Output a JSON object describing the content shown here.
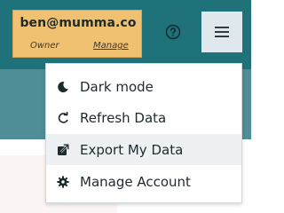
{
  "account": {
    "email": "ben@mumma.co",
    "role": "Owner",
    "manage_label": "Manage"
  },
  "header": {
    "help_icon": "question-circle-icon",
    "menu_icon": "hamburger-icon"
  },
  "menu": {
    "items": [
      {
        "label": "Dark mode",
        "icon": "moon-icon"
      },
      {
        "label": "Refresh Data",
        "icon": "refresh-icon"
      },
      {
        "label": "Export My Data",
        "icon": "export-icon",
        "highlighted": true
      },
      {
        "label": "Manage Account",
        "icon": "gear-icon"
      }
    ]
  },
  "colors": {
    "topbar": "#1f7279",
    "account_box": "#f0c171",
    "menu_highlight": "#edf1f4"
  }
}
